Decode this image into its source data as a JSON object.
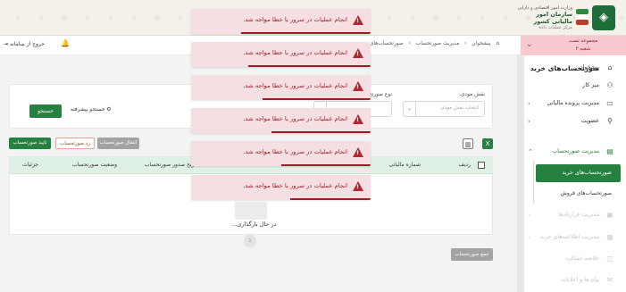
{
  "header": {
    "ministry_line": "وزارت امور اقتصادی و دارایی",
    "org_name": "سازمان امور مالیاتی کشور",
    "sub_line": "مرکز عملیات داده"
  },
  "user": {
    "line1": "مجموعه تست",
    "line2": "شعبه ۲"
  },
  "sidebar": {
    "items": [
      {
        "label": "پیشخوان",
        "icon": "home-icon"
      },
      {
        "label": "میز کار",
        "icon": "people-icon"
      },
      {
        "label": "مدیریت پرونده مالیاتی",
        "icon": "folder-icon"
      },
      {
        "label": "عضویت",
        "icon": "person-icon"
      },
      {
        "label": "مدیریت صورتحساب",
        "icon": "invoice-icon"
      },
      {
        "label": "مدیریت قراردادها",
        "icon": "contract-icon"
      },
      {
        "label": "مدیریت اطلاعیه‌های خرید",
        "icon": "notice-icon"
      },
      {
        "label": "خلاصه عملکرد",
        "icon": "summary-icon"
      },
      {
        "label": "پیام ها و اعلانات",
        "icon": "message-icon"
      }
    ],
    "sub_active": "صورتحساب‌های خرید",
    "sub_other": "صورتحساب‌های فروش"
  },
  "topnav": {
    "crumbs": [
      "پیشخوان",
      "مدیریت صورتحساب",
      "صورتحساب‌های خرید"
    ],
    "exit_label": "خروج از سامانه"
  },
  "page": {
    "title": "صورتحساب‌های خرید"
  },
  "search": {
    "role_label": "نقش مودی:",
    "role_placeholder": "انتخاب نقش مودی",
    "type_label": "نوع صورتح",
    "search_button": "جستجو",
    "advanced_label": "جستجو پیشرفته"
  },
  "toolbar": {
    "approve": "تایید صورتحساب",
    "reject": "رد صورتحساب",
    "transfer": "انتقال صورتحساب"
  },
  "table": {
    "columns": [
      "ردیف",
      "شماره مالیاتی",
      "تاریخ صدور صورتحساب",
      "وضعیت صورتحساب",
      "جزئیات"
    ],
    "loading": "در حال بارگذاری..."
  },
  "footer": {
    "sum_button": "جمع صورتحساب"
  },
  "toasts": [
    {
      "message": "انجام عملیات در سرور با خطا مواجه شد.",
      "progress": 0.72
    },
    {
      "message": "انجام عملیات در سرور با خطا مواجه شد.",
      "progress": 0.68
    },
    {
      "message": "انجام عملیات در سرور با خطا مواجه شد.",
      "progress": 0.6
    },
    {
      "message": "انجام عملیات در سرور با خطا مواجه شد.",
      "progress": 0.55
    },
    {
      "message": "انجام عملیات در سرور با خطا مواجه شد.",
      "progress": 0.5
    },
    {
      "message": "انجام عملیات در سرور با خطا مواجه شد.",
      "progress": 0.45
    }
  ],
  "colors": {
    "brand_green": "#24813f",
    "error_red": "#a11b25",
    "toast_bg": "#f6dfe2"
  }
}
